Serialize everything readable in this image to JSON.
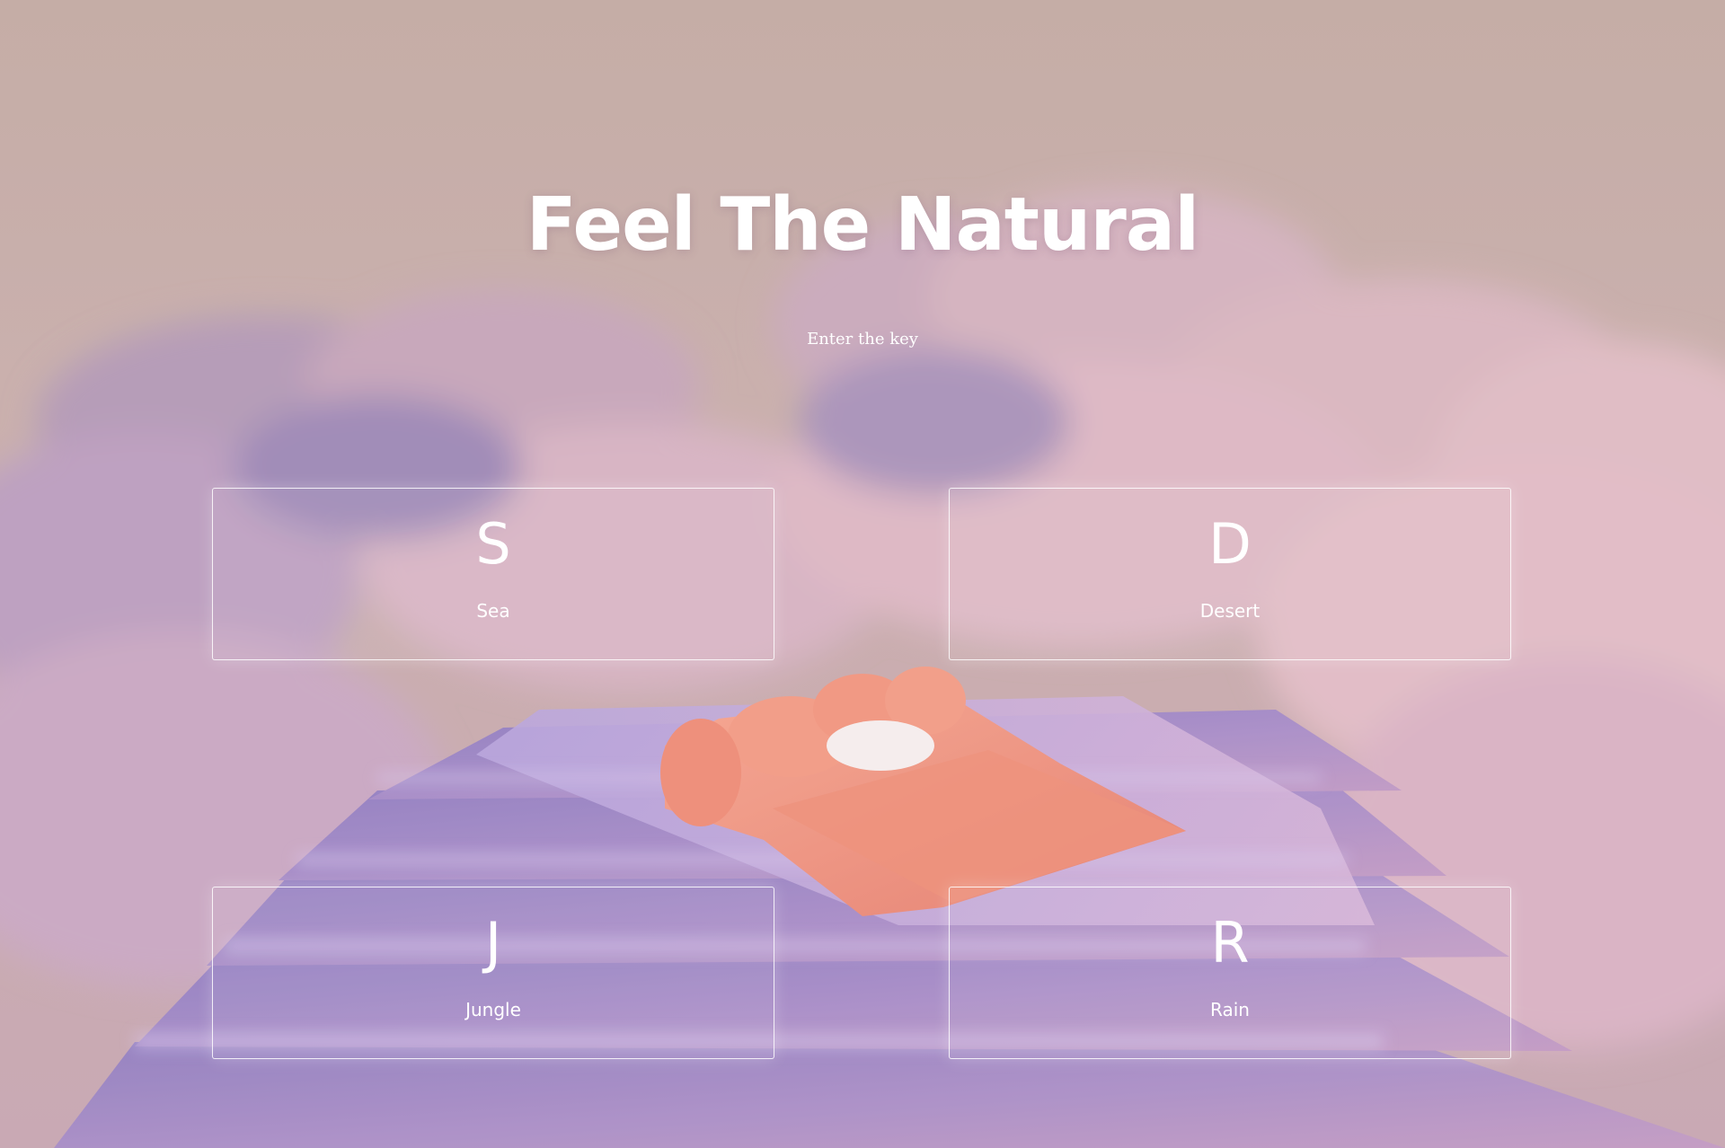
{
  "page": {
    "title": "Feel The Natural",
    "subtitle": "Enter the key"
  },
  "keys": [
    {
      "letter": "S",
      "label": "Sea"
    },
    {
      "letter": "D",
      "label": "Desert"
    },
    {
      "letter": "J",
      "label": "Jungle"
    },
    {
      "letter": "R",
      "label": "Rain"
    }
  ],
  "background": {
    "subject": "bed on stacked mattresses among pink clouds",
    "colors": {
      "sky": "#c3aba3",
      "cloud": "#d9b3bf",
      "cloud_shadow": "#9a85b6",
      "mattress": "#a78fcc",
      "bed": "#f2957f",
      "pillow": "#f6efef"
    }
  }
}
